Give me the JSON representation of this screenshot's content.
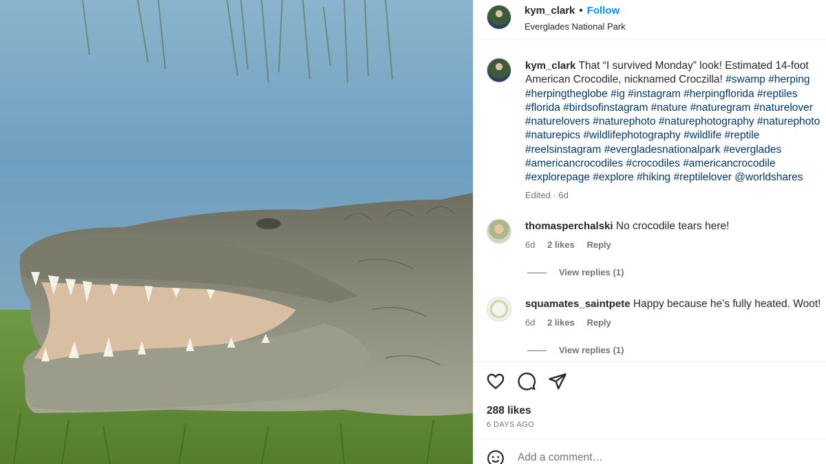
{
  "post": {
    "username": "kym_clark",
    "follow_label": "Follow",
    "location": "Everglades National Park",
    "image_icon": "crocodile-photo"
  },
  "caption": {
    "username": "kym_clark",
    "lines": [
      "That “I survived Monday” look! Estimated 14-foot",
      "American Crocodile, nicknamed Croczilla!"
    ],
    "hashtags_lines": [
      [
        "#swamp",
        "#herping"
      ],
      [
        "#herpingtheglobe",
        "#ig",
        "#instagram",
        "#herpingflorida",
        "#reptiles"
      ],
      [
        "#florida",
        "#birdsofinstagram",
        "#nature",
        "#naturegram",
        "#naturelover"
      ],
      [
        "#naturelovers",
        "#naturephoto",
        "#naturephotography",
        "#naturephoto"
      ],
      [
        "#naturepics",
        "#wildlifephotography",
        "#wildlife",
        "#reptile"
      ],
      [
        "#reelsinstagram",
        "#evergladesnationalpark",
        "#everglades"
      ],
      [
        "#americancrocodiles",
        "#crocodiles",
        "#americancrocodile"
      ],
      [
        "#explorepage",
        "#explore",
        "#hiking",
        "#reptilelover",
        "@worldshares"
      ]
    ],
    "edited": "Edited · 6d"
  },
  "comments": [
    {
      "username": "thomasperchalski",
      "text": "No crocodile tears here!",
      "time": "6d",
      "likes": "2 likes",
      "reply": "Reply",
      "view_replies": "View replies (1)"
    },
    {
      "username": "squamates_saintpete",
      "text": "Happy because he’s fully heated. Woot!",
      "time": "6d",
      "likes": "2 likes",
      "reply": "Reply",
      "view_replies": "View replies (1)"
    }
  ],
  "actions": {
    "likes": "288 likes",
    "time_ago": "6 DAYS AGO",
    "icons": [
      "heart-icon",
      "comment-icon",
      "share-icon"
    ]
  },
  "add_comment": {
    "placeholder": "Add a comment…",
    "icon": "emoji-icon"
  }
}
